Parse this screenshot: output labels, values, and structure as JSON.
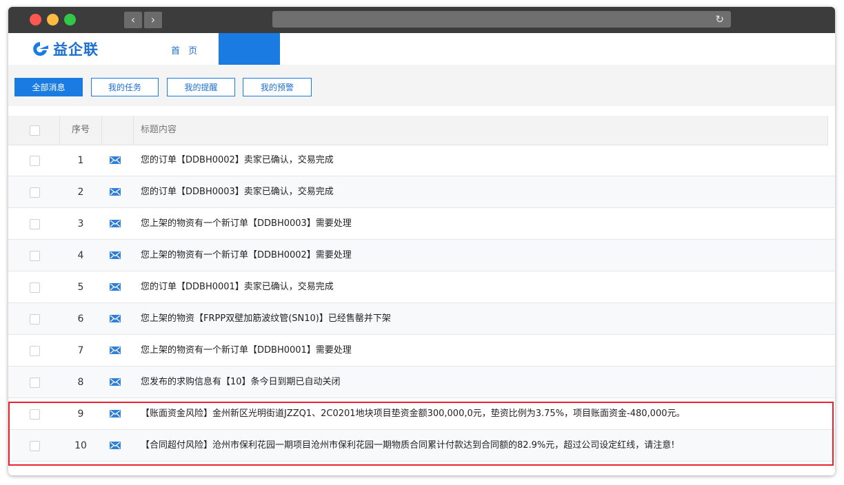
{
  "browser": {
    "back_icon": "chevron-left-icon",
    "forward_icon": "chevron-right-icon",
    "reload_icon": "reload-icon"
  },
  "app": {
    "brand": "益企联",
    "nav_home": "首 页",
    "brand_color": "#1a7ce3"
  },
  "tabs": [
    {
      "label": "全部消息",
      "active": true
    },
    {
      "label": "我的任务",
      "active": false
    },
    {
      "label": "我的提醒",
      "active": false
    },
    {
      "label": "我的预警",
      "active": false
    }
  ],
  "table": {
    "col_index": "序号",
    "col_title": "标题内容",
    "rows": [
      {
        "index": "1",
        "title": "您的订单【DDBH0002】卖家已确认，交易完成"
      },
      {
        "index": "2",
        "title": "您的订单【DDBH0003】卖家已确认，交易完成"
      },
      {
        "index": "3",
        "title": "您上架的物资有一个新订单【DDBH0003】需要处理"
      },
      {
        "index": "4",
        "title": "您上架的物资有一个新订单【DDBH0002】需要处理"
      },
      {
        "index": "5",
        "title": "您的订单【DDBH0001】卖家已确认，交易完成"
      },
      {
        "index": "6",
        "title": "您上架的物资【FRPP双壁加筋波纹管(SN10)】已经售罄并下架"
      },
      {
        "index": "7",
        "title": "您上架的物资有一个新订单【DDBH0001】需要处理"
      },
      {
        "index": "8",
        "title": "您发布的求购信息有【10】条今日到期已自动关闭"
      },
      {
        "index": "9",
        "title": "【账面资金风险】金州新区光明街道JZZQ1、2C0201地块项目垫资金额300,000,0元，垫资比例为3.75%，项目账面资金-480,000元。"
      },
      {
        "index": "10",
        "title": "【合同超付风险】沧州市保利花园一期项目沧州市保利花园一期物质合同累计付款达到合同额的82.9%元，超过公司设定红线，请注意!"
      }
    ]
  },
  "highlight_color": "#e8222c"
}
